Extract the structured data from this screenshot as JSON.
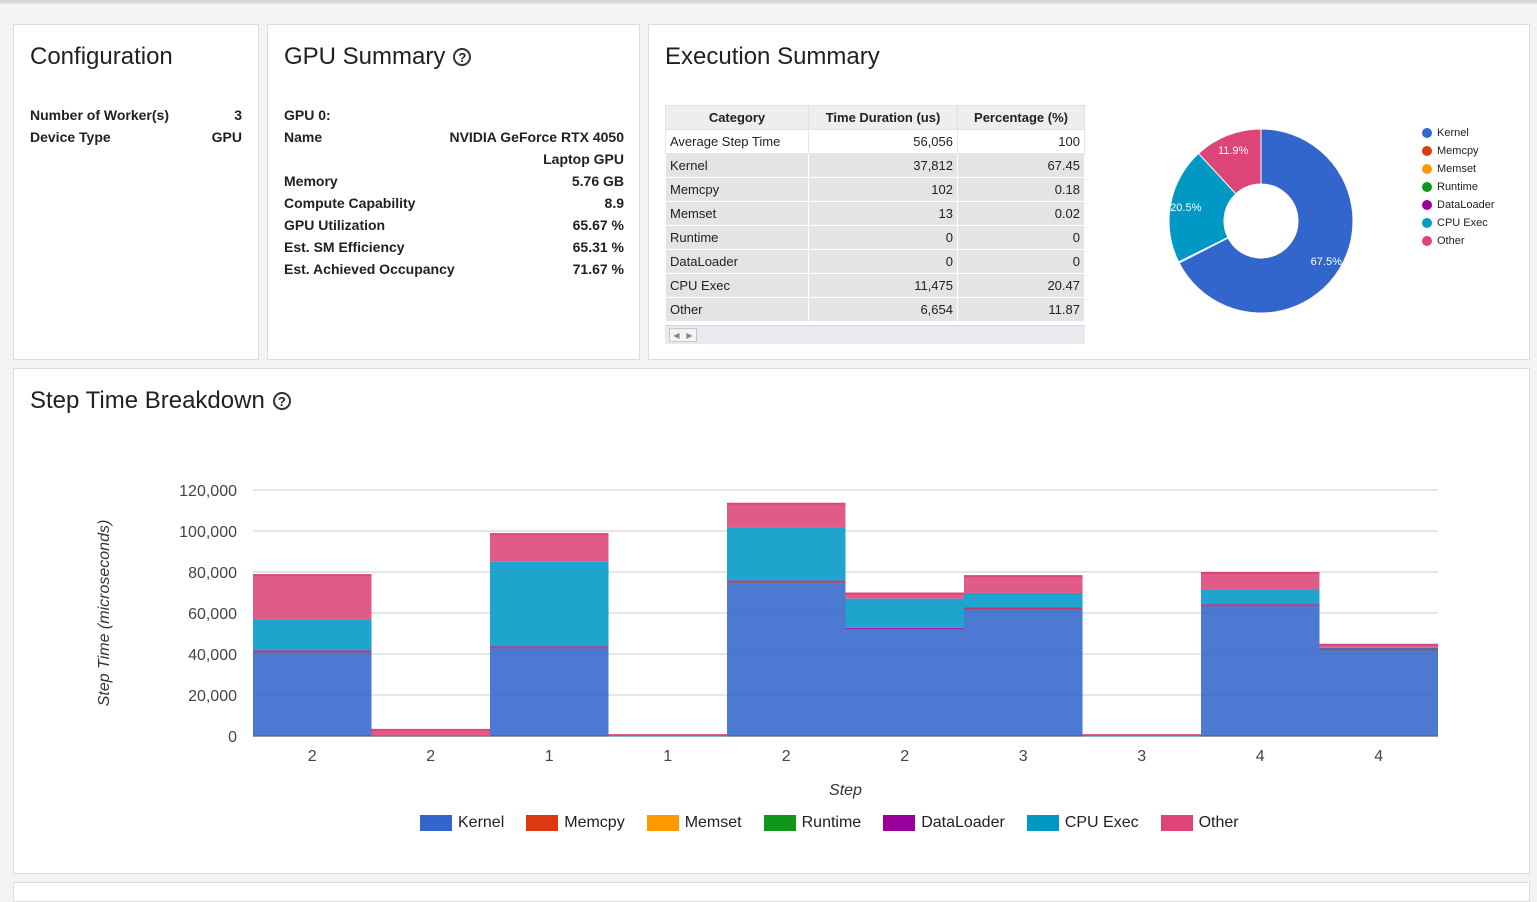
{
  "configuration": {
    "title": "Configuration",
    "rows": [
      {
        "label": "Number of Worker(s)",
        "value": "3"
      },
      {
        "label": "Device Type",
        "value": "GPU"
      }
    ]
  },
  "gpu_summary": {
    "title": "GPU Summary",
    "help_icon": "question-circle-icon",
    "device_heading": "GPU 0:",
    "rows": [
      {
        "label": "Name",
        "value": "NVIDIA GeForce RTX 4050",
        "value2": "Laptop GPU"
      },
      {
        "label": "Memory",
        "value": "5.76 GB"
      },
      {
        "label": "Compute Capability",
        "value": "8.9"
      },
      {
        "label": "GPU Utilization",
        "value": "65.67 %"
      },
      {
        "label": "Est. SM Efficiency",
        "value": "65.31 %"
      },
      {
        "label": "Est. Achieved Occupancy",
        "value": "71.67 %"
      }
    ]
  },
  "execution_summary": {
    "title": "Execution Summary",
    "columns": [
      "Category",
      "Time Duration (us)",
      "Percentage (%)"
    ],
    "rows": [
      {
        "category": "Average Step Time",
        "duration": "56,056",
        "percentage": "100"
      },
      {
        "category": "Kernel",
        "duration": "37,812",
        "percentage": "67.45"
      },
      {
        "category": "Memcpy",
        "duration": "102",
        "percentage": "0.18"
      },
      {
        "category": "Memset",
        "duration": "13",
        "percentage": "0.02"
      },
      {
        "category": "Runtime",
        "duration": "0",
        "percentage": "0"
      },
      {
        "category": "DataLoader",
        "duration": "0",
        "percentage": "0"
      },
      {
        "category": "CPU Exec",
        "duration": "11,475",
        "percentage": "20.47"
      },
      {
        "category": "Other",
        "duration": "6,654",
        "percentage": "11.87"
      }
    ],
    "pie": {
      "type": "pie",
      "slices": [
        {
          "name": "Kernel",
          "value": 67.45,
          "label": "67.5%"
        },
        {
          "name": "Memcpy",
          "value": 0.18,
          "label": ""
        },
        {
          "name": "Memset",
          "value": 0.02,
          "label": ""
        },
        {
          "name": "Runtime",
          "value": 0,
          "label": ""
        },
        {
          "name": "DataLoader",
          "value": 0,
          "label": ""
        },
        {
          "name": "CPU Exec",
          "value": 20.47,
          "label": "20.5%"
        },
        {
          "name": "Other",
          "value": 11.87,
          "label": "11.9%"
        }
      ],
      "legend": [
        "Kernel",
        "Memcpy",
        "Memset",
        "Runtime",
        "DataLoader",
        "CPU Exec",
        "Other"
      ],
      "legend_placement": "right"
    }
  },
  "colors": {
    "Kernel": "#3366cc",
    "Memcpy": "#dc3912",
    "Memset": "#ff9900",
    "Runtime": "#109618",
    "DataLoader": "#990099",
    "CPU Exec": "#0099c6",
    "Other": "#dd4477"
  },
  "step_time": {
    "title": "Step Time Breakdown",
    "help_icon": "question-circle-icon"
  },
  "chart_data": {
    "type": "area",
    "stepped": true,
    "stacked": true,
    "xlabel": "Step",
    "ylabel": "Step Time (microseconds)",
    "ylim": [
      0,
      120000
    ],
    "yticks": [
      0,
      20000,
      40000,
      60000,
      80000,
      100000,
      120000
    ],
    "ytick_labels": [
      "0",
      "20,000",
      "40,000",
      "60,000",
      "80,000",
      "100,000",
      "120,000"
    ],
    "categories": [
      "2",
      "2",
      "1",
      "1",
      "2",
      "2",
      "3",
      "3",
      "4",
      "4"
    ],
    "grid": true,
    "legend_placement": "bottom",
    "series": [
      {
        "name": "Kernel",
        "values": [
          41000,
          0,
          43000,
          0,
          75000,
          52000,
          62000,
          0,
          63500,
          42000
        ]
      },
      {
        "name": "Memcpy",
        "values": [
          200,
          0,
          200,
          0,
          200,
          200,
          200,
          0,
          200,
          200
        ]
      },
      {
        "name": "Memset",
        "values": [
          0,
          0,
          0,
          0,
          0,
          0,
          0,
          0,
          0,
          0
        ]
      },
      {
        "name": "Runtime",
        "values": [
          0,
          0,
          0,
          0,
          0,
          0,
          0,
          0,
          0,
          0
        ]
      },
      {
        "name": "DataLoader",
        "values": [
          600,
          0,
          600,
          0,
          600,
          600,
          600,
          0,
          600,
          600
        ]
      },
      {
        "name": "CPU Exec",
        "values": [
          15200,
          0,
          41200,
          100,
          25700,
          14200,
          7000,
          100,
          7200,
          200
        ]
      },
      {
        "name": "Other",
        "values": [
          21500,
          3000,
          13500,
          300,
          11800,
          2500,
          8200,
          300,
          8000,
          1500
        ]
      }
    ]
  }
}
